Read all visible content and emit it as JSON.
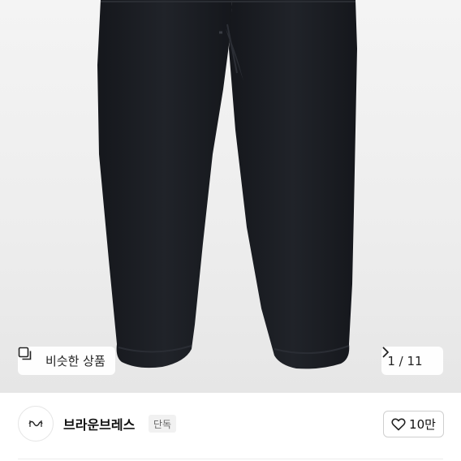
{
  "product": {
    "image_alt": "black knit jogger pants",
    "similar_button": {
      "label": "비슷한 상품",
      "icon": "similar-items-icon"
    },
    "pager": {
      "text": "1 / 11",
      "current": 1,
      "total": 11,
      "icon": "chevron-right-icon"
    }
  },
  "brand": {
    "name": "브라운브레스",
    "badge": "단독",
    "logo_icon": "brand-logo-icon"
  },
  "like": {
    "count_label": "10만",
    "icon": "heart-outline-icon"
  },
  "colors": {
    "pants": "#1b1d22",
    "background": "#efefef",
    "border": "#cfcfcf"
  }
}
